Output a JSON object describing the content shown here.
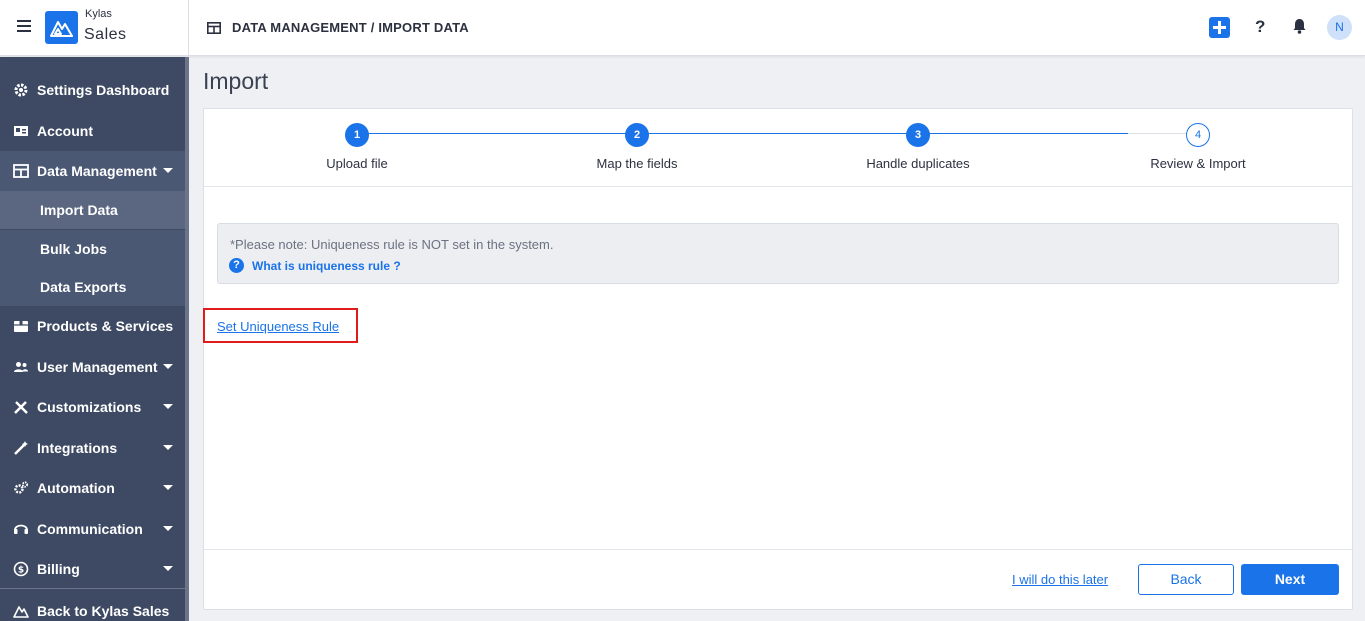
{
  "app": {
    "brand_small": "Kylas",
    "brand_main": "Sales"
  },
  "header": {
    "breadcrumb": "DATA MANAGEMENT / IMPORT DATA",
    "help_label": "?",
    "avatar_initial": "N"
  },
  "sidebar": {
    "items": [
      {
        "label": "Settings Dashboard",
        "icon": "gear-icon"
      },
      {
        "label": "Account",
        "icon": "id-card-icon"
      },
      {
        "label": "Data Management",
        "icon": "table-icon",
        "expanded": true
      },
      {
        "label": "Products & Services",
        "icon": "box-icon"
      },
      {
        "label": "User Management",
        "icon": "users-icon"
      },
      {
        "label": "Customizations",
        "icon": "tools-icon"
      },
      {
        "label": "Integrations",
        "icon": "magic-wand-icon"
      },
      {
        "label": "Automation",
        "icon": "cogs-icon"
      },
      {
        "label": "Communication",
        "icon": "headset-icon"
      },
      {
        "label": "Billing",
        "icon": "dollar-circle-icon"
      },
      {
        "label": "Back to Kylas Sales",
        "icon": "kylas-logo-icon"
      }
    ],
    "sub_items": [
      {
        "label": "Import Data",
        "selected": true
      },
      {
        "label": "Bulk Jobs"
      },
      {
        "label": "Data Exports"
      }
    ]
  },
  "main": {
    "title": "Import",
    "steps": [
      {
        "number": "1",
        "label": "Upload file",
        "status": "done"
      },
      {
        "number": "2",
        "label": "Map the fields",
        "status": "done"
      },
      {
        "number": "3",
        "label": "Handle duplicates",
        "status": "current"
      },
      {
        "number": "4",
        "label": "Review & Import",
        "status": "pending"
      }
    ],
    "note": {
      "text": "*Please note: Uniqueness rule is NOT set in the system.",
      "help_icon": "?",
      "link": "What is uniqueness rule ?"
    },
    "rule_link": "Set Uniqueness Rule",
    "footer": {
      "later_link": "I will do this later",
      "back_label": "Back",
      "next_label": "Next"
    }
  },
  "colors": {
    "accent": "#1a73e8",
    "sidebar_bg": "#3e4a63",
    "highlight": "#e01b1b"
  }
}
